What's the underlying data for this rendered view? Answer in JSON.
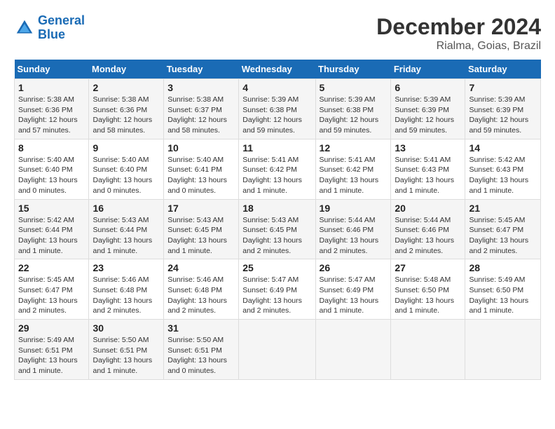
{
  "header": {
    "logo_line1": "General",
    "logo_line2": "Blue",
    "title": "December 2024",
    "subtitle": "Rialma, Goias, Brazil"
  },
  "days_of_week": [
    "Sunday",
    "Monday",
    "Tuesday",
    "Wednesday",
    "Thursday",
    "Friday",
    "Saturday"
  ],
  "weeks": [
    [
      {
        "day": "1",
        "sunrise": "5:38 AM",
        "sunset": "6:36 PM",
        "daylight": "12 hours and 57 minutes."
      },
      {
        "day": "2",
        "sunrise": "5:38 AM",
        "sunset": "6:36 PM",
        "daylight": "12 hours and 58 minutes."
      },
      {
        "day": "3",
        "sunrise": "5:38 AM",
        "sunset": "6:37 PM",
        "daylight": "12 hours and 58 minutes."
      },
      {
        "day": "4",
        "sunrise": "5:39 AM",
        "sunset": "6:38 PM",
        "daylight": "12 hours and 59 minutes."
      },
      {
        "day": "5",
        "sunrise": "5:39 AM",
        "sunset": "6:38 PM",
        "daylight": "12 hours and 59 minutes."
      },
      {
        "day": "6",
        "sunrise": "5:39 AM",
        "sunset": "6:39 PM",
        "daylight": "12 hours and 59 minutes."
      },
      {
        "day": "7",
        "sunrise": "5:39 AM",
        "sunset": "6:39 PM",
        "daylight": "12 hours and 59 minutes."
      }
    ],
    [
      {
        "day": "8",
        "sunrise": "5:40 AM",
        "sunset": "6:40 PM",
        "daylight": "13 hours and 0 minutes."
      },
      {
        "day": "9",
        "sunrise": "5:40 AM",
        "sunset": "6:40 PM",
        "daylight": "13 hours and 0 minutes."
      },
      {
        "day": "10",
        "sunrise": "5:40 AM",
        "sunset": "6:41 PM",
        "daylight": "13 hours and 0 minutes."
      },
      {
        "day": "11",
        "sunrise": "5:41 AM",
        "sunset": "6:42 PM",
        "daylight": "13 hours and 1 minute."
      },
      {
        "day": "12",
        "sunrise": "5:41 AM",
        "sunset": "6:42 PM",
        "daylight": "13 hours and 1 minute."
      },
      {
        "day": "13",
        "sunrise": "5:41 AM",
        "sunset": "6:43 PM",
        "daylight": "13 hours and 1 minute."
      },
      {
        "day": "14",
        "sunrise": "5:42 AM",
        "sunset": "6:43 PM",
        "daylight": "13 hours and 1 minute."
      }
    ],
    [
      {
        "day": "15",
        "sunrise": "5:42 AM",
        "sunset": "6:44 PM",
        "daylight": "13 hours and 1 minute."
      },
      {
        "day": "16",
        "sunrise": "5:43 AM",
        "sunset": "6:44 PM",
        "daylight": "13 hours and 1 minute."
      },
      {
        "day": "17",
        "sunrise": "5:43 AM",
        "sunset": "6:45 PM",
        "daylight": "13 hours and 1 minute."
      },
      {
        "day": "18",
        "sunrise": "5:43 AM",
        "sunset": "6:45 PM",
        "daylight": "13 hours and 2 minutes."
      },
      {
        "day": "19",
        "sunrise": "5:44 AM",
        "sunset": "6:46 PM",
        "daylight": "13 hours and 2 minutes."
      },
      {
        "day": "20",
        "sunrise": "5:44 AM",
        "sunset": "6:46 PM",
        "daylight": "13 hours and 2 minutes."
      },
      {
        "day": "21",
        "sunrise": "5:45 AM",
        "sunset": "6:47 PM",
        "daylight": "13 hours and 2 minutes."
      }
    ],
    [
      {
        "day": "22",
        "sunrise": "5:45 AM",
        "sunset": "6:47 PM",
        "daylight": "13 hours and 2 minutes."
      },
      {
        "day": "23",
        "sunrise": "5:46 AM",
        "sunset": "6:48 PM",
        "daylight": "13 hours and 2 minutes."
      },
      {
        "day": "24",
        "sunrise": "5:46 AM",
        "sunset": "6:48 PM",
        "daylight": "13 hours and 2 minutes."
      },
      {
        "day": "25",
        "sunrise": "5:47 AM",
        "sunset": "6:49 PM",
        "daylight": "13 hours and 2 minutes."
      },
      {
        "day": "26",
        "sunrise": "5:47 AM",
        "sunset": "6:49 PM",
        "daylight": "13 hours and 1 minute."
      },
      {
        "day": "27",
        "sunrise": "5:48 AM",
        "sunset": "6:50 PM",
        "daylight": "13 hours and 1 minute."
      },
      {
        "day": "28",
        "sunrise": "5:49 AM",
        "sunset": "6:50 PM",
        "daylight": "13 hours and 1 minute."
      }
    ],
    [
      {
        "day": "29",
        "sunrise": "5:49 AM",
        "sunset": "6:51 PM",
        "daylight": "13 hours and 1 minute."
      },
      {
        "day": "30",
        "sunrise": "5:50 AM",
        "sunset": "6:51 PM",
        "daylight": "13 hours and 1 minute."
      },
      {
        "day": "31",
        "sunrise": "5:50 AM",
        "sunset": "6:51 PM",
        "daylight": "13 hours and 0 minutes."
      },
      null,
      null,
      null,
      null
    ]
  ]
}
